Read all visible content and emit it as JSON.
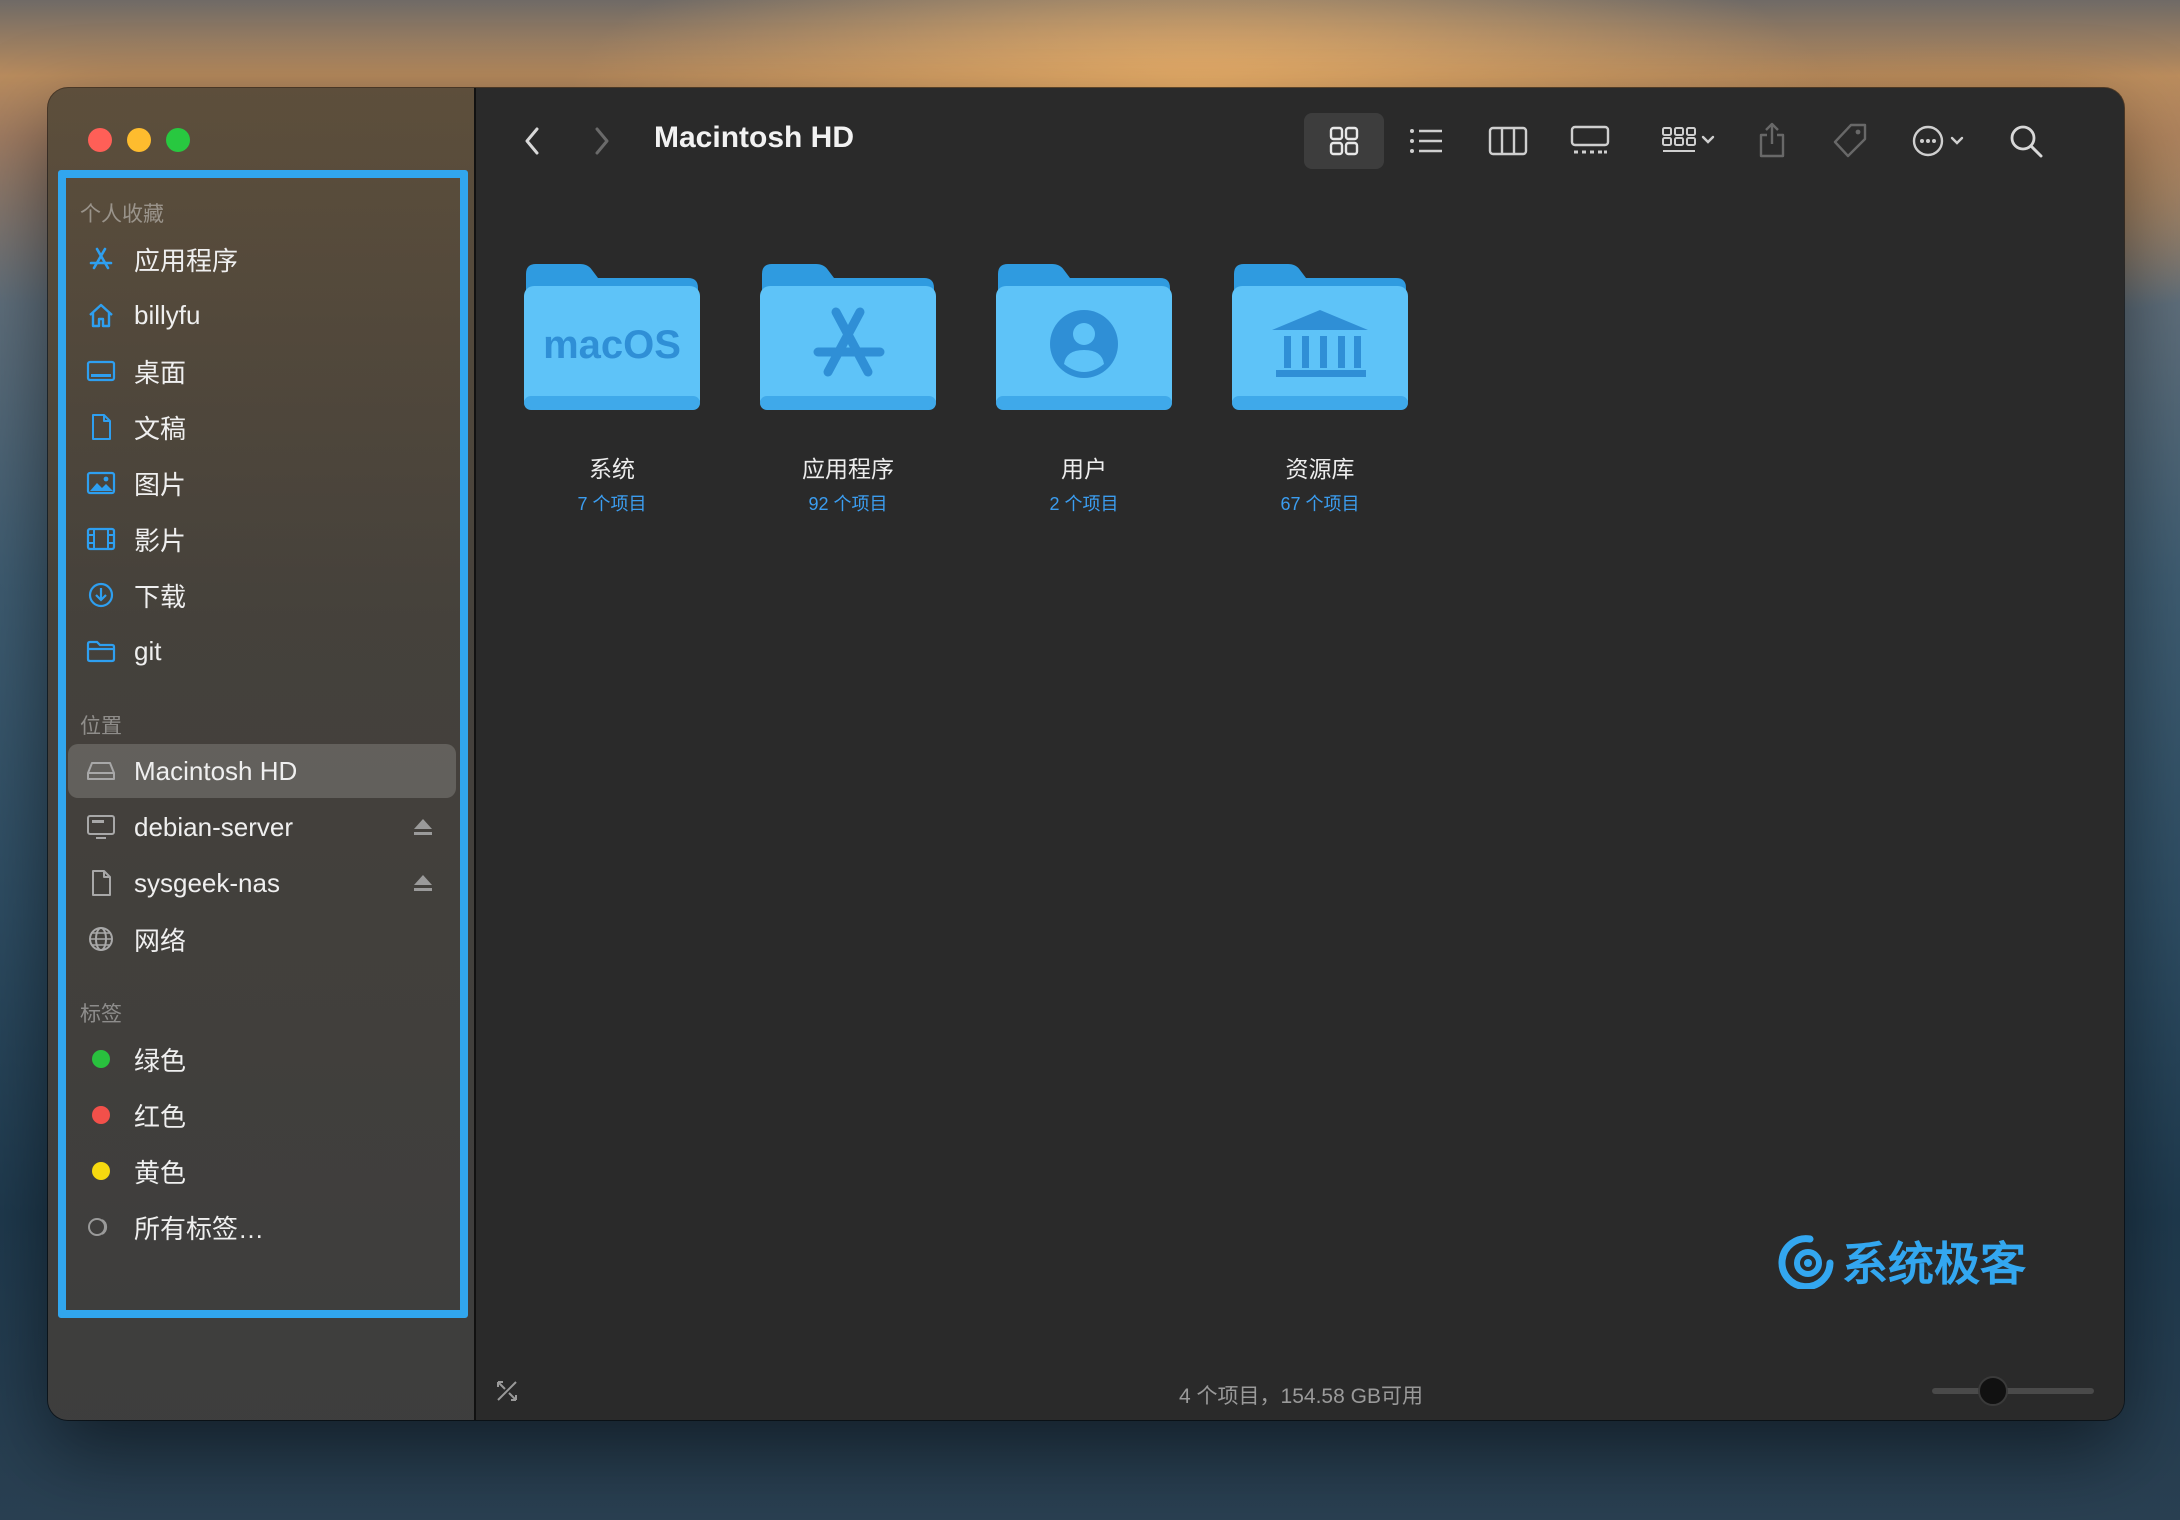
{
  "window": {
    "title": "Macintosh HD"
  },
  "sidebar": {
    "favorites_header": "个人收藏",
    "favorites": [
      {
        "label": "应用程序",
        "icon": "app-store-icon"
      },
      {
        "label": "billyfu",
        "icon": "home-icon"
      },
      {
        "label": "桌面",
        "icon": "desktop-icon"
      },
      {
        "label": "文稿",
        "icon": "document-icon"
      },
      {
        "label": "图片",
        "icon": "photo-icon"
      },
      {
        "label": "影片",
        "icon": "film-icon"
      },
      {
        "label": "下载",
        "icon": "download-icon"
      },
      {
        "label": "git",
        "icon": "folder-icon"
      }
    ],
    "locations_header": "位置",
    "locations": [
      {
        "label": "Macintosh HD",
        "icon": "hard-drive-icon",
        "selected": true
      },
      {
        "label": "debian-server",
        "icon": "server-icon",
        "eject": true
      },
      {
        "label": "sysgeek-nas",
        "icon": "document-icon",
        "eject": true
      },
      {
        "label": "网络",
        "icon": "network-icon"
      }
    ],
    "tags_header": "标签",
    "tags": [
      {
        "label": "绿色",
        "color": "#29c13e"
      },
      {
        "label": "红色",
        "color": "#f2504a"
      },
      {
        "label": "黄色",
        "color": "#f6d90f"
      },
      {
        "label": "所有标签…",
        "color": "none"
      }
    ]
  },
  "toolbar": {
    "icons": [
      "back-icon",
      "forward-icon",
      "icon-view-icon",
      "list-view-icon",
      "column-view-icon",
      "gallery-view-icon",
      "group-icon",
      "share-icon",
      "tag-icon",
      "more-icon",
      "search-icon"
    ]
  },
  "folders": [
    {
      "name": "系统",
      "count": "7 个项目",
      "glyph": "macOS"
    },
    {
      "name": "应用程序",
      "count": "92 个项目",
      "glyph": "app-store"
    },
    {
      "name": "用户",
      "count": "2 个项目",
      "glyph": "user"
    },
    {
      "name": "资源库",
      "count": "67 个项目",
      "glyph": "library"
    }
  ],
  "status": {
    "text": "4 个项目，154.58 GB可用",
    "zoom_level": 0.35
  },
  "watermark": {
    "text": "系统极客"
  },
  "colors": {
    "accent": "#31a6ee",
    "folder": "#5ec3f8",
    "folder_dark": "#2f9be0"
  }
}
